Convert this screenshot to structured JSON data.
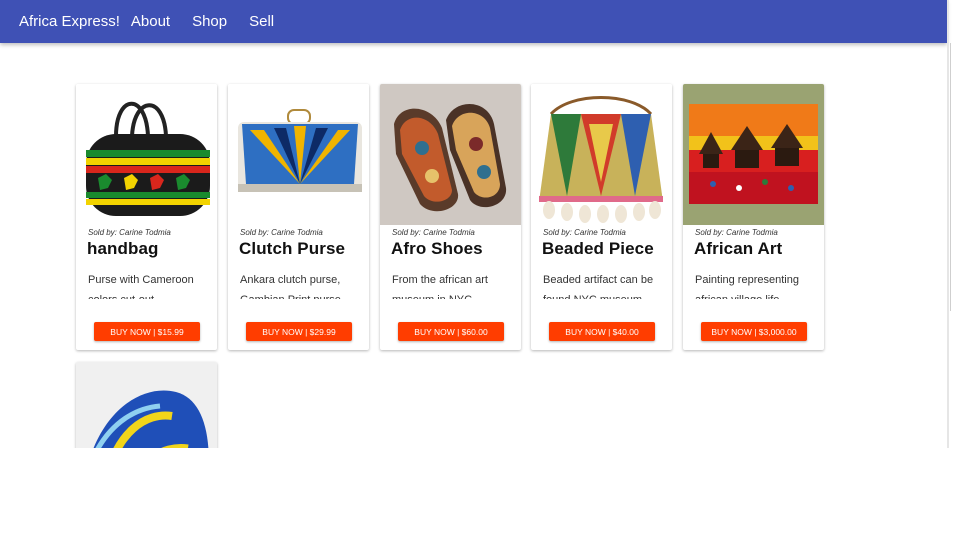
{
  "appbar": {
    "brand": "Africa Express!",
    "links": [
      "About",
      "Shop",
      "Sell"
    ]
  },
  "colors": {
    "appbar": "#3f51b5",
    "buy_button": "#ff3d00"
  },
  "products": [
    {
      "seller": "Sold by: Carine Todmia",
      "title": "handbag",
      "description": "Purse with Cameroon colors cut-out",
      "button": "BUY NOW | $15.99"
    },
    {
      "seller": "Sold by: Carine Todmia",
      "title": "Clutch Purse",
      "description": "Ankara clutch purse, Gambian Print purse",
      "button": "BUY NOW | $29.99"
    },
    {
      "seller": "Sold by: Carine Todmia",
      "title": "Afro Shoes",
      "description": "From the african art museum in NYC",
      "button": "BUY NOW | $60.00"
    },
    {
      "seller": "Sold by: Carine Todmia",
      "title": "Beaded Piece",
      "description": "Beaded artifact can be found NYC museum",
      "button": "BUY NOW | $40.00"
    },
    {
      "seller": "Sold by: Carine Todmia",
      "title": "African Art",
      "description": "Painting representing african village life",
      "button": "BUY NOW | $3,000.00"
    }
  ]
}
